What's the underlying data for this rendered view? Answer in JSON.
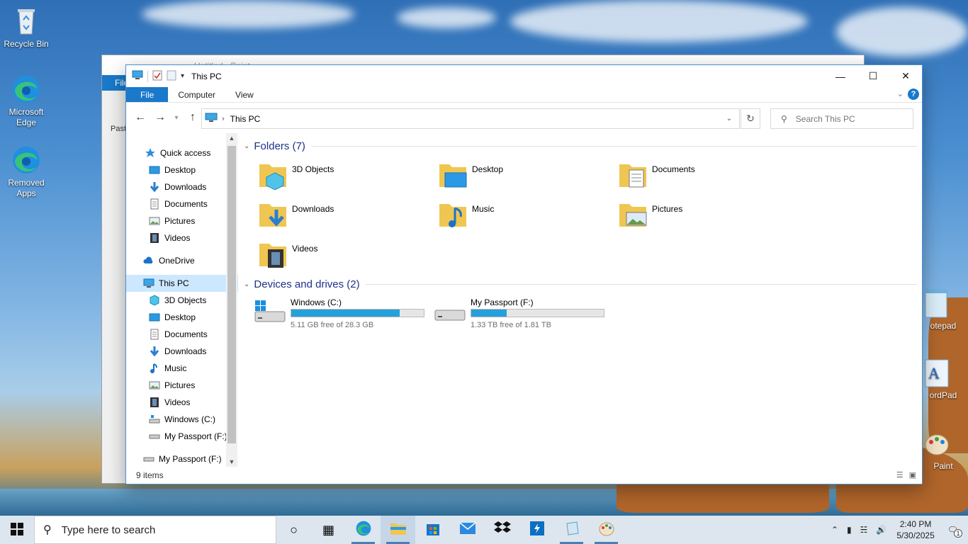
{
  "desktop": {
    "icons": [
      {
        "label": "Recycle Bin",
        "icon": "recycle-bin-icon"
      },
      {
        "label": "Microsoft Edge",
        "icon": "edge-icon"
      },
      {
        "label": "Removed Apps",
        "icon": "edge-icon"
      },
      {
        "label": "otepad",
        "icon": "notepad-icon"
      },
      {
        "label": "ordPad",
        "icon": "wordpad-icon"
      },
      {
        "label": "Paint",
        "icon": "paint-icon"
      }
    ]
  },
  "paint_window": {
    "title": "Untitled - Paint",
    "file_tab": "File",
    "paste_label": "Past"
  },
  "explorer": {
    "title": "This PC",
    "ribbon_tabs": [
      "File",
      "Computer",
      "View"
    ],
    "help_label": "?",
    "address": {
      "path": "This PC"
    },
    "search": {
      "placeholder": "Search This PC"
    },
    "nav": {
      "quick_access": "Quick access",
      "quick_items": [
        "Desktop",
        "Downloads",
        "Documents",
        "Pictures",
        "Videos"
      ],
      "onedrive": "OneDrive",
      "this_pc": "This PC",
      "pc_items": [
        "3D Objects",
        "Desktop",
        "Documents",
        "Downloads",
        "Music",
        "Pictures",
        "Videos",
        "Windows (C:)",
        "My Passport (F:)"
      ],
      "external": "My Passport (F:)"
    },
    "folders_header": "Folders (7)",
    "folders": [
      {
        "name": "3D Objects",
        "icon": "3d-objects-icon"
      },
      {
        "name": "Desktop",
        "icon": "desktop-folder-icon"
      },
      {
        "name": "Documents",
        "icon": "documents-folder-icon"
      },
      {
        "name": "Downloads",
        "icon": "downloads-folder-icon"
      },
      {
        "name": "Music",
        "icon": "music-folder-icon"
      },
      {
        "name": "Pictures",
        "icon": "pictures-folder-icon"
      },
      {
        "name": "Videos",
        "icon": "videos-folder-icon"
      }
    ],
    "drives_header": "Devices and drives (2)",
    "drives": [
      {
        "name": "Windows (C:)",
        "free": "5.11 GB free of 28.3 GB",
        "used_fraction": 0.82,
        "icon": "windows-drive-icon"
      },
      {
        "name": "My Passport (F:)",
        "free": "1.33 TB free of 1.81 TB",
        "used_fraction": 0.27,
        "icon": "external-drive-icon"
      }
    ],
    "status": "9 items"
  },
  "taskbar": {
    "search_placeholder": "Type here to search",
    "apps": [
      "task-view-icon",
      "edge-icon",
      "file-explorer-icon",
      "store-icon",
      "mail-icon",
      "dropbox-icon",
      "power-automate-icon",
      "notepad-icon",
      "paint-icon"
    ],
    "time": "2:40 PM",
    "date": "5/30/2025",
    "notification_count": "1"
  },
  "colors": {
    "accent": "#1979ca",
    "drive_fill": "#26a0da",
    "selection": "#cce8ff",
    "group_header": "#1e3287"
  }
}
